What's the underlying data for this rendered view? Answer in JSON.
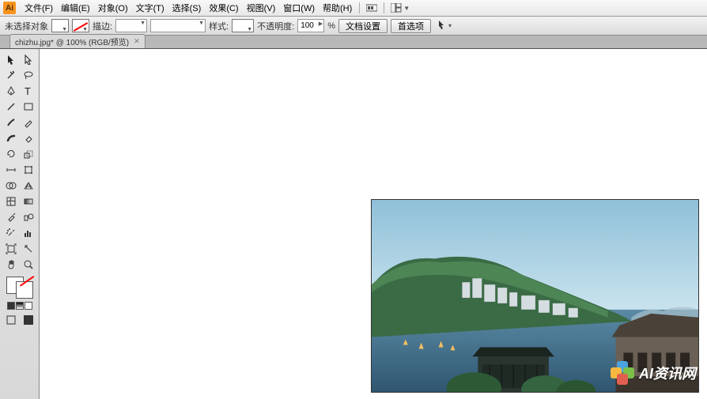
{
  "menu": {
    "items": [
      "文件(F)",
      "编辑(E)",
      "对象(O)",
      "文字(T)",
      "选择(S)",
      "效果(C)",
      "视图(V)",
      "窗口(W)",
      "帮助(H)"
    ]
  },
  "ctrl": {
    "no_selection": "未选择对象",
    "stroke_label": "描边:",
    "style_label": "样式:",
    "opacity_label": "不透明度:",
    "opacity_value": "100",
    "opacity_unit": "%",
    "doc_setup": "文档设置",
    "preferences": "首选项"
  },
  "tab": {
    "title": "chizhu.jpg* @ 100% (RGB/预览)"
  },
  "watermark": {
    "text": "AI资讯网"
  },
  "colors": {
    "accent": "#f7931e",
    "sky1": "#a8cde0",
    "sky2": "#c8e2ed",
    "sea1": "#3a5f7a",
    "sea2": "#4a7290",
    "hill1": "#2d5a3a",
    "hill2": "#4a7a50",
    "mountain": "#9ab5c0",
    "building": "#c8d0d5",
    "dark_building": "#5a5045"
  }
}
